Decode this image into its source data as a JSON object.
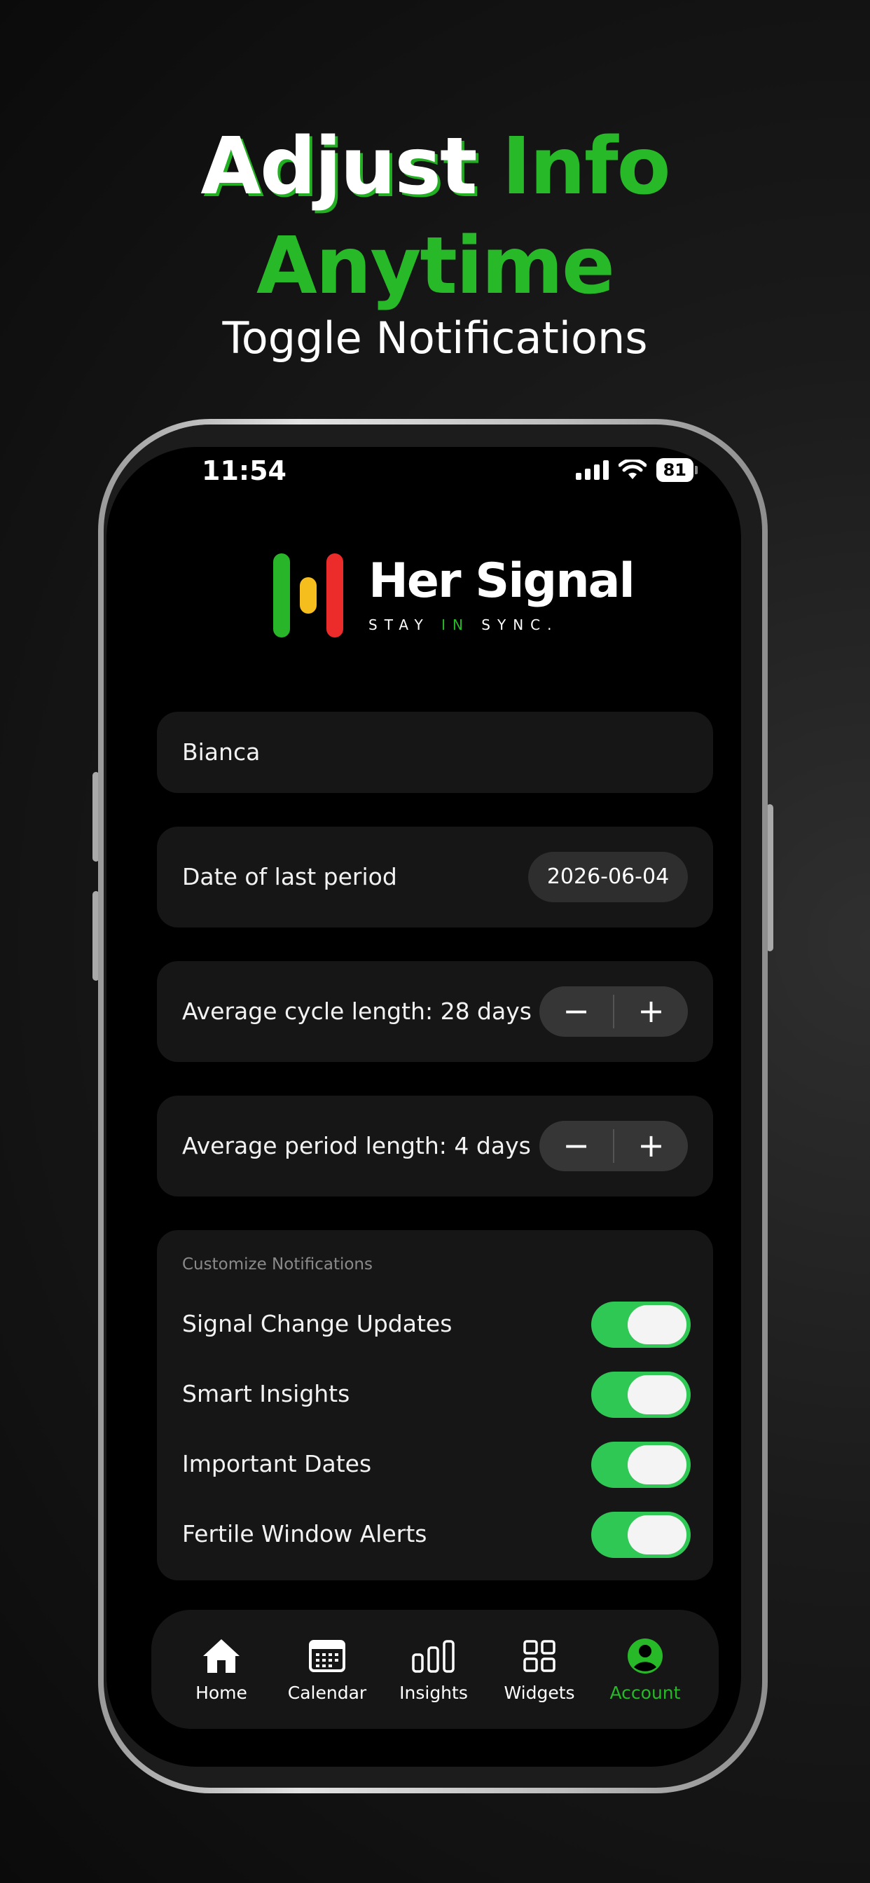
{
  "headline": {
    "line1_white": "Adjust",
    "line1_green": "Info",
    "line2_green": "Anytime",
    "subtitle": "Toggle Notifications"
  },
  "status_bar": {
    "time": "11:54",
    "battery": "81"
  },
  "brand": {
    "name": "Her Signal",
    "tagline_before": "STAY",
    "tagline_highlight": "IN",
    "tagline_after": "SYNC.",
    "mark_colors": [
      "#29b52a",
      "#f5be1c",
      "#ec2b2b"
    ]
  },
  "form": {
    "name_value": "Bianca",
    "last_period_label": "Date of last period",
    "last_period_value": "2026-06-04",
    "cycle_label": "Average cycle length: 28 days",
    "period_label": "Average period length: 4 days",
    "stepper_minus": "−",
    "stepper_plus": "+"
  },
  "notifications": {
    "heading": "Customize Notifications",
    "items": [
      {
        "label": "Signal Change Updates",
        "enabled": true
      },
      {
        "label": "Smart Insights",
        "enabled": true
      },
      {
        "label": "Important Dates",
        "enabled": true
      },
      {
        "label": "Fertile Window Alerts",
        "enabled": true
      }
    ]
  },
  "tabs": [
    {
      "label": "Home",
      "icon": "home-icon"
    },
    {
      "label": "Calendar",
      "icon": "calendar-icon"
    },
    {
      "label": "Insights",
      "icon": "bar-chart-icon"
    },
    {
      "label": "Widgets",
      "icon": "grid-icon"
    },
    {
      "label": "Account",
      "icon": "account-icon",
      "active": true
    }
  ],
  "colors": {
    "accent_green": "#27b927",
    "toggle_green": "#30c855"
  }
}
